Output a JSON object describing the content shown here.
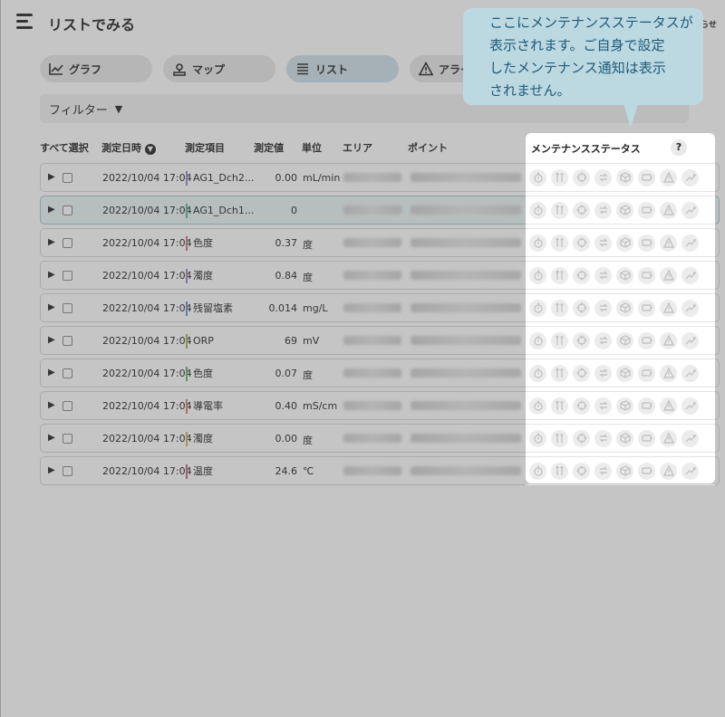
{
  "header": {
    "title": "リストでみる",
    "notice_label": "らせ"
  },
  "tabs": [
    {
      "label": "グラフ",
      "icon": "chart-icon"
    },
    {
      "label": "マップ",
      "icon": "map-pin-icon"
    },
    {
      "label": "リスト",
      "icon": "list-icon",
      "active": true
    },
    {
      "label": "アラー",
      "icon": "alert-icon"
    }
  ],
  "filter": {
    "label": "フィルター"
  },
  "table": {
    "headers": {
      "select_all": "すべて選択",
      "datetime": "測定日時",
      "item": "測定項目",
      "value": "測定値",
      "unit": "単位",
      "area": "エリア",
      "point": "ポイント"
    },
    "rows": [
      {
        "datetime": "2022/10/04 17:04",
        "item": "AG1_Dch2...",
        "value": "0.00",
        "unit": "mL/min",
        "color": "#8a8ac8"
      },
      {
        "datetime": "2022/10/04 17:04",
        "item": "AG1_Dch1...",
        "value": "0",
        "unit": "",
        "color": "#5ab0a0"
      },
      {
        "datetime": "2022/10/04 17:04",
        "item": "色度",
        "value": "0.37",
        "unit": "度",
        "color": "#d07080"
      },
      {
        "datetime": "2022/10/04 17:04",
        "item": "濁度",
        "value": "0.84",
        "unit": "度",
        "color": "#a080c0"
      },
      {
        "datetime": "2022/10/04 17:04",
        "item": "残留塩素",
        "value": "0.014",
        "unit": "mg/L",
        "color": "#6a8ad0"
      },
      {
        "datetime": "2022/10/04 17:04",
        "item": "ORP",
        "value": "69",
        "unit": "mV",
        "color": "#a0b050"
      },
      {
        "datetime": "2022/10/04 17:04",
        "item": "色度",
        "value": "0.07",
        "unit": "度",
        "color": "#60b070"
      },
      {
        "datetime": "2022/10/04 17:04",
        "item": "導電率",
        "value": "0.40",
        "unit": "mS/cm",
        "color": "#d08070"
      },
      {
        "datetime": "2022/10/04 17:04",
        "item": "濁度",
        "value": "0.00",
        "unit": "度",
        "color": "#d0b060"
      },
      {
        "datetime": "2022/10/04 17:04",
        "item": "温度",
        "value": "24.6",
        "unit": "℃",
        "color": "#c06090"
      }
    ]
  },
  "maintenance": {
    "title": "メンテナンスステータス",
    "help": "?",
    "icons": [
      "timer-icon",
      "tools-icon",
      "target-icon",
      "refresh-icon",
      "box-icon",
      "battery-icon",
      "warning-icon",
      "signal-icon"
    ]
  },
  "tooltip": {
    "lines": [
      "ここにメンテナンスステータスが",
      "表示されます。ご自身で設定",
      "したメンテナンス通知は表示",
      "されません。"
    ]
  }
}
